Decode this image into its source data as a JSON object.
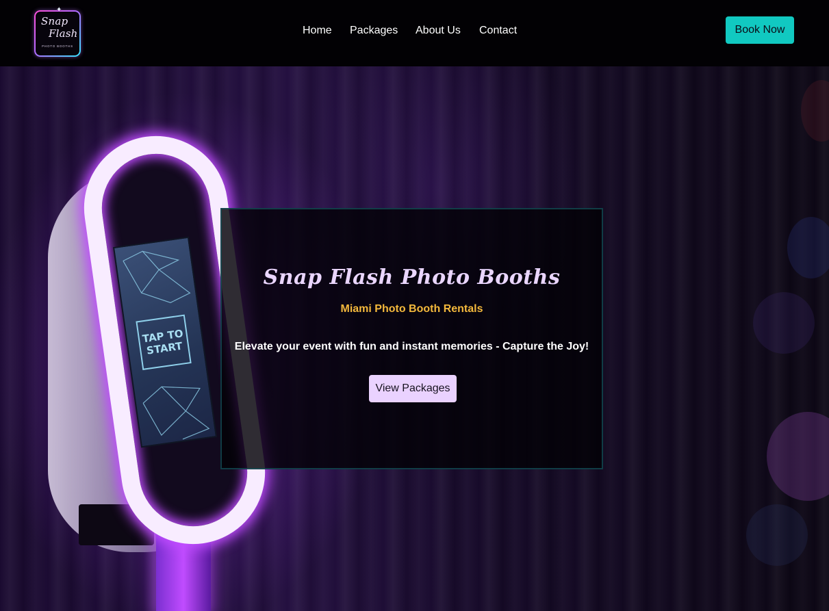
{
  "header": {
    "logo": {
      "line1": "Snap",
      "line2": "Flash",
      "sub": "PHOTO BOOTHS"
    },
    "nav": [
      {
        "label": "Home"
      },
      {
        "label": "Packages"
      },
      {
        "label": "About Us"
      },
      {
        "label": "Contact"
      }
    ],
    "book_button": "Book Now"
  },
  "hero": {
    "title": "Snap Flash Photo Booths",
    "subtitle": "Miami Photo Booth Rentals",
    "tagline": "Elevate your event with fun and instant memories - Capture the Joy!",
    "button": "View Packages",
    "background_image": {
      "screen_text": "TAP TO START"
    }
  },
  "colors": {
    "accent_teal": "#11c9c1",
    "highlight_gold": "#f3b83c",
    "title_lavender": "#ead6ff",
    "button_lavender": "#ead2ff",
    "header_bg": "#020104"
  }
}
